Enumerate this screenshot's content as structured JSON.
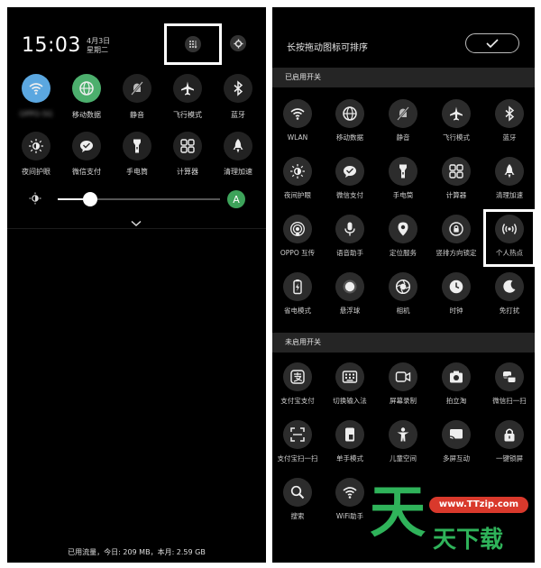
{
  "left_panel": {
    "time": "15:03",
    "date_line1": "4月3日",
    "date_line2": "星期二",
    "tiles_row1": [
      {
        "label": "OPPO-5G",
        "icon": "wifi-icon",
        "active": true,
        "color": "#5ba7e0"
      },
      {
        "label": "移动数据",
        "icon": "globe-icon",
        "active": true,
        "color": "#4caf6d"
      },
      {
        "label": "静音",
        "icon": "bell-off-icon",
        "active": false
      },
      {
        "label": "飞行模式",
        "icon": "airplane-icon",
        "active": false
      },
      {
        "label": "蓝牙",
        "icon": "bluetooth-icon",
        "active": false
      }
    ],
    "tiles_row2": [
      {
        "label": "夜间护眼",
        "icon": "eye-sun-icon"
      },
      {
        "label": "微信支付",
        "icon": "wechat-pay-icon"
      },
      {
        "label": "手电筒",
        "icon": "flashlight-icon"
      },
      {
        "label": "计算器",
        "icon": "calculator-icon"
      },
      {
        "label": "清理加速",
        "icon": "rocket-icon"
      }
    ],
    "avatar_letter": "A",
    "usage_text": "已用流量，今日: 209 MB，本月: 2.59 GB",
    "brightness_level": 0.2
  },
  "right_panel": {
    "title": "长按拖动图标可排序",
    "enabled_header": "已启用开关",
    "disabled_header": "未启用开关",
    "enabled_tiles": [
      {
        "label": "WLAN",
        "icon": "wifi-icon"
      },
      {
        "label": "移动数据",
        "icon": "globe-icon"
      },
      {
        "label": "静音",
        "icon": "bell-off-icon"
      },
      {
        "label": "飞行模式",
        "icon": "airplane-icon"
      },
      {
        "label": "蓝牙",
        "icon": "bluetooth-icon"
      },
      {
        "label": "夜间护眼",
        "icon": "eye-sun-icon"
      },
      {
        "label": "微信支付",
        "icon": "wechat-pay-icon"
      },
      {
        "label": "手电筒",
        "icon": "flashlight-icon"
      },
      {
        "label": "计算器",
        "icon": "calculator-icon"
      },
      {
        "label": "清理加速",
        "icon": "rocket-icon"
      },
      {
        "label": "OPPO 互传",
        "icon": "share-icon"
      },
      {
        "label": "语音助手",
        "icon": "mic-icon"
      },
      {
        "label": "定位服务",
        "icon": "location-icon"
      },
      {
        "label": "竖排方向锁定",
        "icon": "rotation-lock-icon"
      },
      {
        "label": "个人热点",
        "icon": "hotspot-icon"
      },
      {
        "label": "省电模式",
        "icon": "battery-icon"
      },
      {
        "label": "悬浮球",
        "icon": "float-ball-icon"
      },
      {
        "label": "相机",
        "icon": "camera-icon"
      },
      {
        "label": "时钟",
        "icon": "clock-icon"
      },
      {
        "label": "免打扰",
        "icon": "moon-icon"
      }
    ],
    "disabled_tiles": [
      {
        "label": "支付宝支付",
        "icon": "alipay-icon"
      },
      {
        "label": "切换输入法",
        "icon": "keyboard-icon"
      },
      {
        "label": "屏幕录制",
        "icon": "screen-record-icon"
      },
      {
        "label": "拍立淘",
        "icon": "camera-scan-icon"
      },
      {
        "label": "微信扫一扫",
        "icon": "wechat-scan-icon"
      },
      {
        "label": "支付宝扫一扫",
        "icon": "alipay-scan-icon"
      },
      {
        "label": "单手模式",
        "icon": "one-hand-icon"
      },
      {
        "label": "儿童空间",
        "icon": "child-icon"
      },
      {
        "label": "多屏互动",
        "icon": "cast-icon"
      },
      {
        "label": "一键锁屏",
        "icon": "lock-icon"
      },
      {
        "label": "搜索",
        "icon": "search-icon"
      },
      {
        "label": "WiFi助手",
        "icon": "wifi-assistant-icon"
      }
    ]
  },
  "watermark": {
    "brand_char": "天",
    "site": "www.TTzip.com",
    "text": "天下载"
  }
}
